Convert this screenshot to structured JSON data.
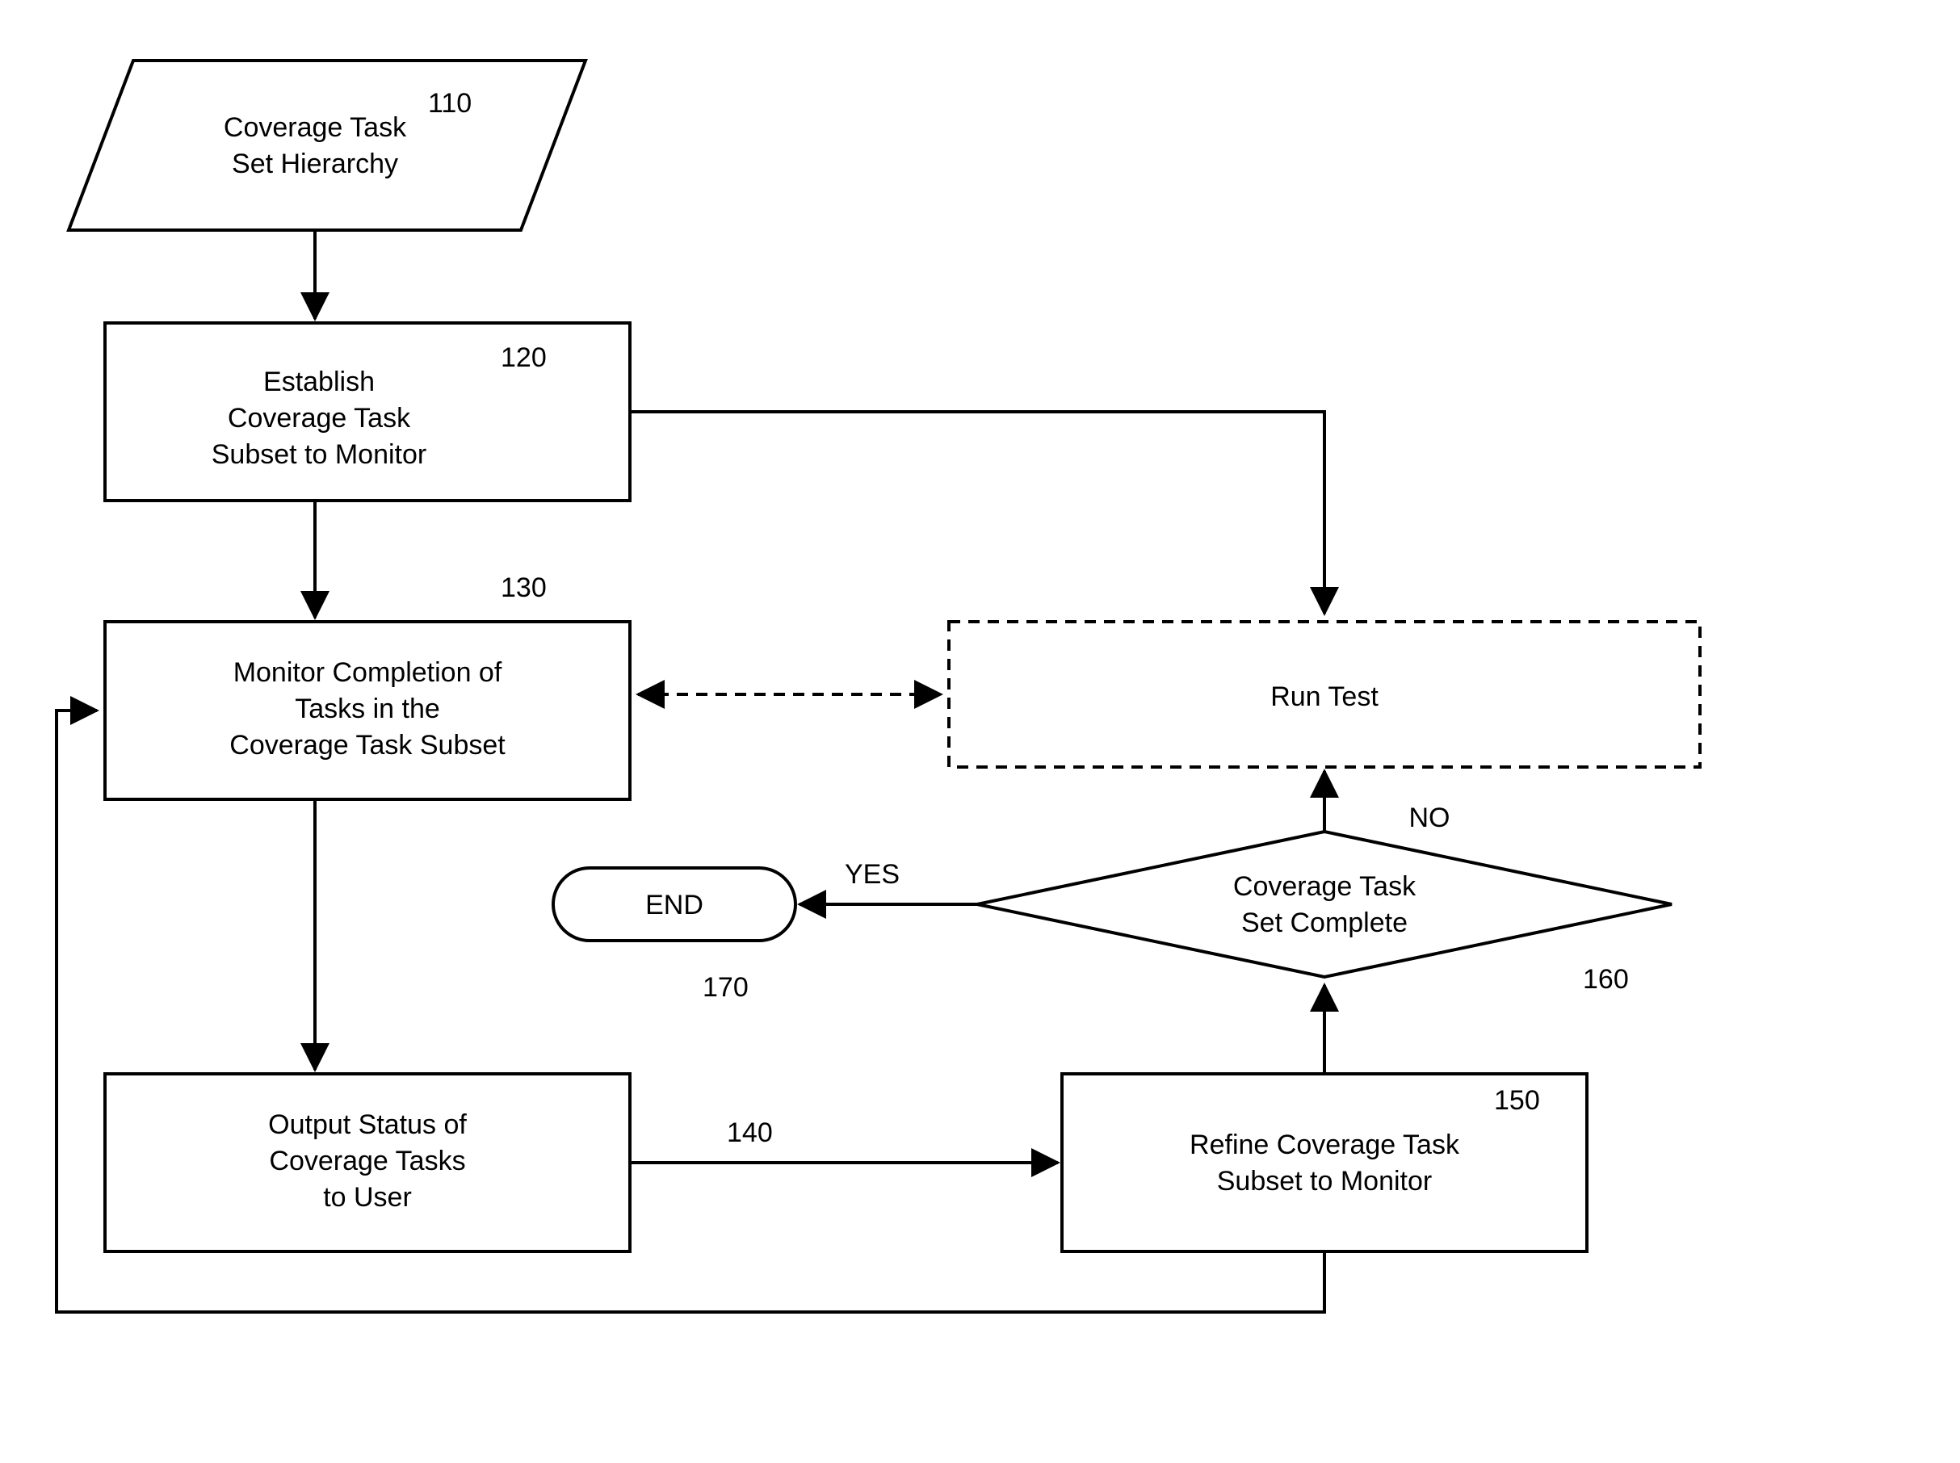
{
  "nodes": {
    "n110": {
      "ref": "110",
      "lines": [
        "Coverage Task",
        "Set Hierarchy"
      ]
    },
    "n120": {
      "ref": "120",
      "lines": [
        "Establish",
        "Coverage Task",
        "Subset to Monitor"
      ]
    },
    "n130": {
      "ref": "130",
      "lines": [
        "Monitor Completion of",
        "Tasks in the",
        "Coverage Task Subset"
      ]
    },
    "n140": {
      "ref": "140",
      "lines": [
        "Output Status of",
        "Coverage Tasks",
        "to User"
      ]
    },
    "n150": {
      "ref": "150",
      "lines": [
        "Refine Coverage Task",
        "Subset to Monitor"
      ]
    },
    "n160": {
      "ref": "160",
      "lines": [
        "Coverage Task",
        "Set Complete"
      ]
    },
    "n170": {
      "ref": "170",
      "lines": [
        "END"
      ]
    },
    "runTest": {
      "lines": [
        "Run Test"
      ]
    }
  },
  "edgeLabels": {
    "yes": "YES",
    "no": "NO"
  }
}
